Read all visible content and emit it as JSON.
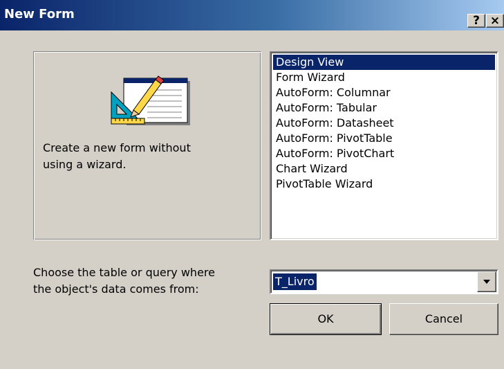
{
  "window": {
    "title": "New Form",
    "help_button": "?",
    "close_button": "×"
  },
  "preview": {
    "icon": "form-design-icon",
    "description": "Create a new form without\nusing a wizard."
  },
  "view_list": {
    "selected_index": 0,
    "items": [
      "Design View",
      "Form Wizard",
      "AutoForm:  Columnar",
      "AutoForm:  Tabular",
      "AutoForm:  Datasheet",
      "AutoForm:  PivotTable",
      "AutoForm:  PivotChart",
      "Chart Wizard",
      "PivotTable Wizard"
    ]
  },
  "source": {
    "label": "Choose the table or query where\nthe object's data comes from:",
    "selected_value": "T_Livro"
  },
  "buttons": {
    "ok": "OK",
    "cancel": "Cancel"
  },
  "colors": {
    "dialog_face": "#d4d0c8",
    "title_start": "#0a246a",
    "title_end": "#a6caf0",
    "selection": "#0a246a"
  }
}
